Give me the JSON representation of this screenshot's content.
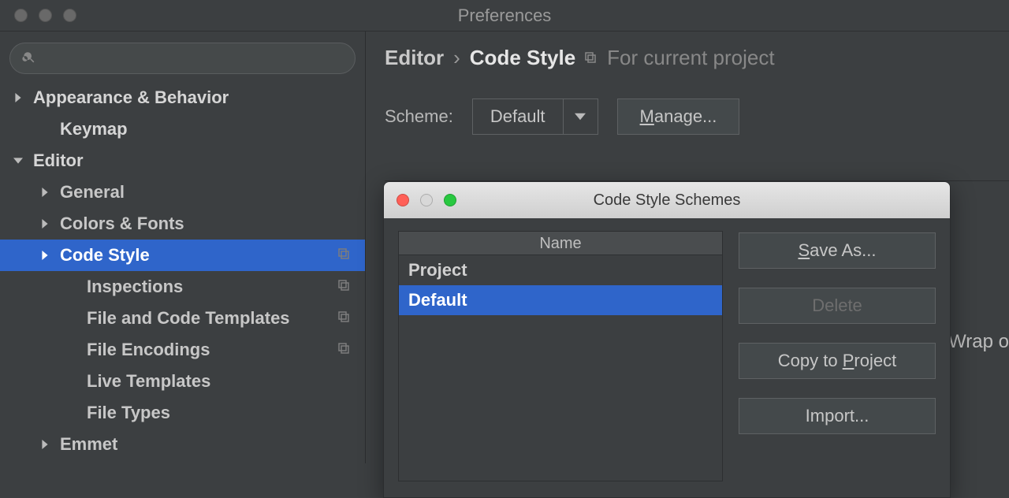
{
  "window": {
    "title": "Preferences"
  },
  "sidebar": {
    "search_placeholder": "",
    "items": [
      {
        "label": "Appearance & Behavior"
      },
      {
        "label": "Keymap"
      },
      {
        "label": "Editor"
      },
      {
        "label": "General"
      },
      {
        "label": "Colors & Fonts"
      },
      {
        "label": "Code Style"
      },
      {
        "label": "Inspections"
      },
      {
        "label": "File and Code Templates"
      },
      {
        "label": "File Encodings"
      },
      {
        "label": "Live Templates"
      },
      {
        "label": "File Types"
      },
      {
        "label": "Emmet"
      }
    ]
  },
  "breadcrumb": {
    "root": "Editor",
    "current": "Code Style",
    "scope": "For current project"
  },
  "scheme": {
    "label": "Scheme:",
    "value": "Default",
    "manage_label": "Manage..."
  },
  "dialog": {
    "title": "Code Style Schemes",
    "column": "Name",
    "rows": [
      "Project",
      "Default"
    ],
    "buttons": {
      "save_as": "Save As...",
      "delete": "Delete",
      "copy_to_project": "Copy to Project",
      "import": "Import..."
    }
  },
  "back_tab": "Wrap o"
}
